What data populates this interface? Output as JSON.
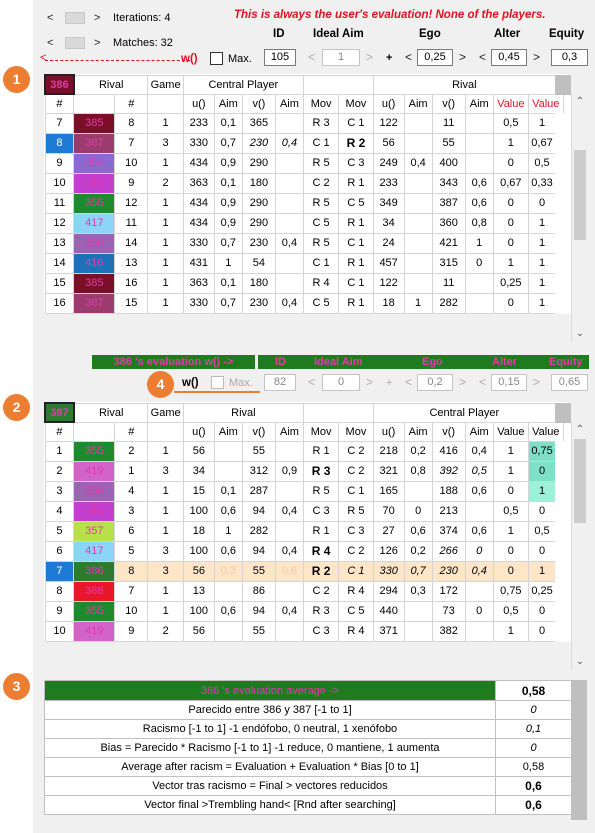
{
  "top": {
    "iterations_label": "Iterations: 4",
    "matches_label": "Matches: 32",
    "warning": "This is always the user's evaluation! None of the players.",
    "w_label": "w()",
    "max_label": "Max.",
    "headers": {
      "id": "ID",
      "ideal_aim": "Ideal Aim",
      "ego": "Ego",
      "alter": "Alter",
      "equity": "Equity"
    },
    "id_value": "105",
    "ideal_aim_value": "1",
    "plus": "+",
    "ego_value": "0,25",
    "alter_value": "0,45",
    "equity_value": "0,3"
  },
  "callouts": [
    "1",
    "2",
    "3",
    "4"
  ],
  "grid1": {
    "player_id": "386",
    "player_color": "#7a1028",
    "group_headers": [
      "Rival",
      "Game",
      "Central Player",
      "Rival"
    ],
    "columns": [
      "#",
      "",
      "#",
      "",
      "u()",
      "Aim",
      "v()",
      "Aim",
      "Mov",
      "Mov",
      "u()",
      "Aim",
      "v()",
      "Aim",
      "Value",
      "Value"
    ],
    "rows": [
      {
        "n": "7",
        "id": "385",
        "c": "#7a1028",
        "r": "8",
        "g": "1",
        "u": "233",
        "a": "0,1",
        "v": "365",
        "a2": "",
        "m1": "R 3",
        "m2": "C 1",
        "u2": "122",
        "a3": "",
        "v2": "11",
        "a4": "",
        "v1": "0,5",
        "v2b": "1"
      },
      {
        "n": "8",
        "id": "387",
        "c": "#9b3c6e",
        "r": "7",
        "g": "3",
        "u": "330",
        "a": "0,7",
        "v": "230",
        "a2": "0,4",
        "m1": "C 1",
        "m2": "R 2",
        "u2": "56",
        "a3": "",
        "v2": "55",
        "a4": "",
        "v1": "1",
        "v2b": "0,67",
        "sel": true
      },
      {
        "n": "9",
        "id": "354",
        "c": "#8a6ad0",
        "r": "10",
        "g": "1",
        "u": "434",
        "a": "0,9",
        "v": "290",
        "a2": "",
        "m1": "R 5",
        "m2": "C 3",
        "u2": "249",
        "a3": "0,4",
        "v2": "400",
        "a4": "",
        "v1": "0",
        "v2b": "0,5"
      },
      {
        "n": "10",
        "id": "418",
        "c": "#c23fd0",
        "r": "9",
        "g": "2",
        "u": "363",
        "a": "0,1",
        "v": "180",
        "a2": "",
        "m1": "C 2",
        "m2": "R 1",
        "u2": "233",
        "a3": "",
        "v2": "343",
        "a4": "0,6",
        "v1": "0,67",
        "v2b": "0,33"
      },
      {
        "n": "11",
        "id": "355",
        "c": "#1e8a2e",
        "r": "12",
        "g": "1",
        "u": "434",
        "a": "0,9",
        "v": "290",
        "a2": "",
        "m1": "R 5",
        "m2": "C 5",
        "u2": "349",
        "a3": "",
        "v2": "387",
        "a4": "0,6",
        "v1": "0",
        "v2b": "0"
      },
      {
        "n": "12",
        "id": "417",
        "c": "#8ad4f5",
        "r": "11",
        "g": "1",
        "u": "434",
        "a": "0,9",
        "v": "290",
        "a2": "",
        "m1": "C 5",
        "m2": "R 1",
        "u2": "34",
        "a3": "",
        "v2": "360",
        "a4": "0,8",
        "v1": "0",
        "v2b": "1"
      },
      {
        "n": "13",
        "id": "356",
        "c": "#9a63b3",
        "r": "14",
        "g": "1",
        "u": "330",
        "a": "0,7",
        "v": "230",
        "a2": "0,4",
        "m1": "R 5",
        "m2": "C 1",
        "u2": "24",
        "a3": "",
        "v2": "421",
        "a4": "1",
        "v1": "0",
        "v2b": "1"
      },
      {
        "n": "14",
        "id": "416",
        "c": "#1e70b8",
        "r": "13",
        "g": "1",
        "u": "431",
        "a": "1",
        "v": "54",
        "a2": "",
        "m1": "C 1",
        "m2": "R 1",
        "u2": "457",
        "a3": "",
        "v2": "315",
        "a4": "0",
        "v1": "1",
        "v2b": "1"
      },
      {
        "n": "15",
        "id": "385",
        "c": "#7a1028",
        "r": "16",
        "g": "1",
        "u": "363",
        "a": "0,1",
        "v": "180",
        "a2": "",
        "m1": "R 4",
        "m2": "C 1",
        "u2": "122",
        "a3": "",
        "v2": "11",
        "a4": "",
        "v1": "0,25",
        "v2b": "1"
      },
      {
        "n": "16",
        "id": "387",
        "c": "#9b3c6e",
        "r": "15",
        "g": "1",
        "u": "330",
        "a": "0,7",
        "v": "230",
        "a2": "0,4",
        "m1": "C 5",
        "m2": "R 1",
        "u2": "18",
        "a3": "1",
        "v2": "282",
        "a4": "",
        "v1": "0",
        "v2b": "1"
      }
    ]
  },
  "eval_bar": {
    "title": "386 's evaluation w() ->",
    "id": "ID",
    "ideal_aim": "Ideal Aim",
    "ego": "Ego",
    "alter": "Alter",
    "equity": "Equity"
  },
  "eval_controls": {
    "w_label": "w()",
    "max_label": "Max.",
    "id_value": "82",
    "ideal_aim_value": "0",
    "plus": "+",
    "ego_value": "0,2",
    "alter_value": "0,15",
    "equity_value": "0,65"
  },
  "grid2": {
    "player_id": "387",
    "player_color": "#2f7a2f",
    "group_headers": [
      "Rival",
      "Game",
      "Rival",
      "Central Player"
    ],
    "columns": [
      "#",
      "",
      "#",
      "",
      "u()",
      "Aim",
      "v()",
      "Aim",
      "Mov",
      "Mov",
      "u()",
      "Aim",
      "v()",
      "Aim",
      "Value",
      "Value"
    ],
    "rows": [
      {
        "n": "1",
        "id": "355",
        "c": "#1e8a2e",
        "r": "2",
        "g": "1",
        "u": "56",
        "a": "",
        "v": "55",
        "a2": "",
        "m1": "R 1",
        "m2": "C 2",
        "u2": "218",
        "a3": "0,2",
        "v2": "416",
        "a4": "0,4",
        "v1": "1",
        "v2b": "0,75",
        "hl": "#7fe0c8"
      },
      {
        "n": "2",
        "id": "419",
        "c": "#d264c8",
        "r": "1",
        "g": "3",
        "u": "34",
        "a": "",
        "v": "312",
        "a2": "0,9",
        "m1": "R 3",
        "m2": "C 2",
        "u2": "321",
        "a3": "0,8",
        "v2": "392",
        "a4": "0,5",
        "v1": "1",
        "v2b": "0",
        "hl": "#7fe0c8"
      },
      {
        "n": "3",
        "id": "356",
        "c": "#9a63b3",
        "r": "4",
        "g": "1",
        "u": "15",
        "a": "0,1",
        "v": "287",
        "a2": "",
        "m1": "R 5",
        "m2": "C 1",
        "u2": "165",
        "a3": "",
        "v2": "188",
        "a4": "0,6",
        "v1": "0",
        "v2b": "1",
        "hl": "#9ff0d8"
      },
      {
        "n": "4",
        "id": "418",
        "c": "#c23fd0",
        "r": "3",
        "g": "1",
        "u": "100",
        "a": "0,6",
        "v": "94",
        "a2": "0,4",
        "m1": "C 3",
        "m2": "R 5",
        "u2": "70",
        "a3": "0",
        "v2": "213",
        "a4": "",
        "v1": "0,5",
        "v2b": "0"
      },
      {
        "n": "5",
        "id": "357",
        "c": "#b8e04a",
        "r": "6",
        "g": "1",
        "u": "18",
        "a": "1",
        "v": "282",
        "a2": "",
        "m1": "R 1",
        "m2": "C 3",
        "u2": "27",
        "a3": "0,6",
        "v2": "374",
        "a4": "0,6",
        "v1": "1",
        "v2b": "0,5"
      },
      {
        "n": "6",
        "id": "417",
        "c": "#8ad4f5",
        "r": "5",
        "g": "3",
        "u": "100",
        "a": "0,6",
        "v": "94",
        "a2": "0,4",
        "m1": "R 4",
        "m2": "C 2",
        "u2": "126",
        "a3": "0,2",
        "v2": "266",
        "a4": "0",
        "v1": "0",
        "v2b": "0"
      },
      {
        "n": "7",
        "id": "386",
        "c": "#2f7a2f",
        "r": "8",
        "g": "3",
        "u": "56",
        "a": "0,3",
        "v": "55",
        "a2": "0,6",
        "m1": "R 2",
        "m2": "C 1",
        "u2": "330",
        "a3": "0,7",
        "v2": "230",
        "a4": "0,4",
        "v1": "0",
        "v2b": "1",
        "sel": true
      },
      {
        "n": "8",
        "id": "388",
        "c": "#e8182a",
        "r": "7",
        "g": "1",
        "u": "13",
        "a": "",
        "v": "86",
        "a2": "",
        "m1": "C 2",
        "m2": "R 4",
        "u2": "294",
        "a3": "0,3",
        "v2": "172",
        "a4": "",
        "v1": "0,75",
        "v2b": "0,25"
      },
      {
        "n": "9",
        "id": "355",
        "c": "#1e8a2e",
        "r": "10",
        "g": "1",
        "u": "100",
        "a": "0,6",
        "v": "94",
        "a2": "0,4",
        "m1": "R 3",
        "m2": "C 5",
        "u2": "440",
        "a3": "",
        "v2": "73",
        "a4": "0",
        "v1": "0,5",
        "v2b": "0"
      },
      {
        "n": "10",
        "id": "419",
        "c": "#d264c8",
        "r": "9",
        "g": "2",
        "u": "56",
        "a": "",
        "v": "55",
        "a2": "",
        "m1": "C 3",
        "m2": "R 4",
        "u2": "371",
        "a3": "",
        "v2": "382",
        "a4": "",
        "v1": "1",
        "v2b": "0"
      }
    ]
  },
  "summary": {
    "title": "386 's evaluation average ->",
    "title_value": "0,58",
    "rows": [
      {
        "label": "Parecido entre 386 y 387  [-1 to 1]",
        "value": "0"
      },
      {
        "label": "Racismo  [-1 to 1]   -1 endófobo, 0 neutral, 1 xenófobo",
        "value": "0,1"
      },
      {
        "label": "Bias = Parecido * Racismo  [-1 to 1]   -1 reduce, 0 mantiene, 1 aumenta",
        "value": "0"
      },
      {
        "label": "Average after racism = Evaluation + Evaluation * Bias  [0 to 1]",
        "value": "0,58"
      },
      {
        "label": "Vector tras racismo = Final > vectores reducidos",
        "value": "0,6"
      },
      {
        "label": "Vector final     >Trembling hand< [Rnd after searching]",
        "value": "0,6"
      }
    ]
  },
  "colors": {
    "accent_red": "#e81123",
    "bar_green": "#1e7b1e",
    "bar_text": "#e23ba8",
    "callout": "#ed7d31",
    "selected_blue": "#1e7ad4",
    "highlight_orange": "#fde6c8"
  }
}
